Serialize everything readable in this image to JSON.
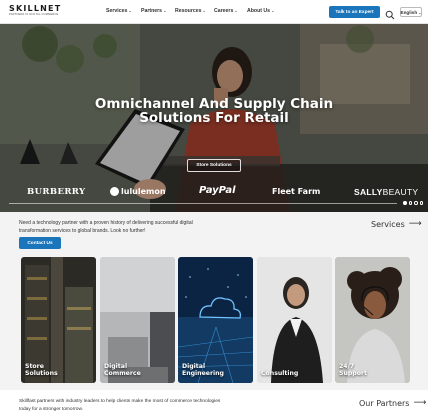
{
  "header": {
    "logo_main": "SKILLNET",
    "logo_sub": "PARTNERS IN DIGITAL COMMERCE",
    "nav": [
      {
        "label": "Services"
      },
      {
        "label": "Partners"
      },
      {
        "label": "Resources"
      },
      {
        "label": "Careers"
      },
      {
        "label": "About Us"
      }
    ],
    "cta_label": "Talk to an Expert",
    "language": "English"
  },
  "hero": {
    "title": "Omnichannel And Supply Chain Solutions For Retail",
    "button_label": "Store Solutions",
    "brands": {
      "burberry": "BURBERRY",
      "lululemon": "lululemon",
      "paypal": "PayPal",
      "fleet": "Fleet Farm",
      "sally_bold": "SALLY",
      "sally_thin": "BEAUTY"
    },
    "slide_count": 4,
    "active_slide": 1
  },
  "intro": {
    "text": "Need a technology partner with a proven history of delivering successful digital transformation services to global brands. Look no further!",
    "contact_label": "Contact Us",
    "services_link": "Services"
  },
  "cards": [
    {
      "label": "Store\nSolutions",
      "icon": "store-shelves"
    },
    {
      "label": "Digital\nCommerce",
      "icon": "laptop"
    },
    {
      "label": "Digital\nEngineering",
      "icon": "cloud-circuit"
    },
    {
      "label": "Consulting",
      "icon": "person"
    },
    {
      "label": "24/7\nSupport",
      "icon": "headset"
    }
  ],
  "partners": {
    "text": "Skillfast partners with industry leaders to help clients make the most of commerce technologies today for a stronger tomorrow.",
    "link": "Our Partners"
  },
  "colors": {
    "accent": "#1b75bb",
    "page_bg": "#f3f3f3"
  }
}
